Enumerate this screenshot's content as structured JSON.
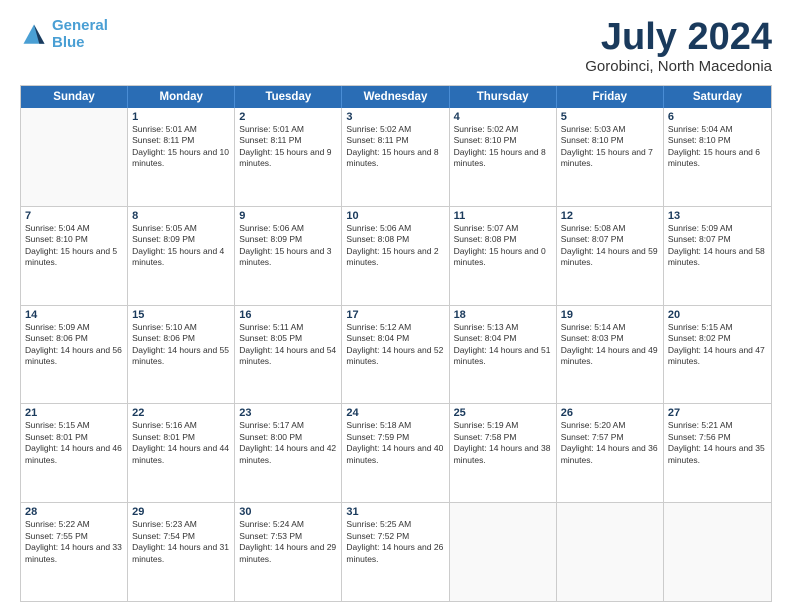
{
  "logo": {
    "line1": "General",
    "line2": "Blue"
  },
  "title": "July 2024",
  "location": "Gorobinci, North Macedonia",
  "header_days": [
    "Sunday",
    "Monday",
    "Tuesday",
    "Wednesday",
    "Thursday",
    "Friday",
    "Saturday"
  ],
  "weeks": [
    [
      {
        "day": "",
        "sunrise": "",
        "sunset": "",
        "daylight": "",
        "empty": true
      },
      {
        "day": "1",
        "sunrise": "Sunrise: 5:01 AM",
        "sunset": "Sunset: 8:11 PM",
        "daylight": "Daylight: 15 hours and 10 minutes."
      },
      {
        "day": "2",
        "sunrise": "Sunrise: 5:01 AM",
        "sunset": "Sunset: 8:11 PM",
        "daylight": "Daylight: 15 hours and 9 minutes."
      },
      {
        "day": "3",
        "sunrise": "Sunrise: 5:02 AM",
        "sunset": "Sunset: 8:11 PM",
        "daylight": "Daylight: 15 hours and 8 minutes."
      },
      {
        "day": "4",
        "sunrise": "Sunrise: 5:02 AM",
        "sunset": "Sunset: 8:10 PM",
        "daylight": "Daylight: 15 hours and 8 minutes."
      },
      {
        "day": "5",
        "sunrise": "Sunrise: 5:03 AM",
        "sunset": "Sunset: 8:10 PM",
        "daylight": "Daylight: 15 hours and 7 minutes."
      },
      {
        "day": "6",
        "sunrise": "Sunrise: 5:04 AM",
        "sunset": "Sunset: 8:10 PM",
        "daylight": "Daylight: 15 hours and 6 minutes."
      }
    ],
    [
      {
        "day": "7",
        "sunrise": "Sunrise: 5:04 AM",
        "sunset": "Sunset: 8:10 PM",
        "daylight": "Daylight: 15 hours and 5 minutes."
      },
      {
        "day": "8",
        "sunrise": "Sunrise: 5:05 AM",
        "sunset": "Sunset: 8:09 PM",
        "daylight": "Daylight: 15 hours and 4 minutes."
      },
      {
        "day": "9",
        "sunrise": "Sunrise: 5:06 AM",
        "sunset": "Sunset: 8:09 PM",
        "daylight": "Daylight: 15 hours and 3 minutes."
      },
      {
        "day": "10",
        "sunrise": "Sunrise: 5:06 AM",
        "sunset": "Sunset: 8:08 PM",
        "daylight": "Daylight: 15 hours and 2 minutes."
      },
      {
        "day": "11",
        "sunrise": "Sunrise: 5:07 AM",
        "sunset": "Sunset: 8:08 PM",
        "daylight": "Daylight: 15 hours and 0 minutes."
      },
      {
        "day": "12",
        "sunrise": "Sunrise: 5:08 AM",
        "sunset": "Sunset: 8:07 PM",
        "daylight": "Daylight: 14 hours and 59 minutes."
      },
      {
        "day": "13",
        "sunrise": "Sunrise: 5:09 AM",
        "sunset": "Sunset: 8:07 PM",
        "daylight": "Daylight: 14 hours and 58 minutes."
      }
    ],
    [
      {
        "day": "14",
        "sunrise": "Sunrise: 5:09 AM",
        "sunset": "Sunset: 8:06 PM",
        "daylight": "Daylight: 14 hours and 56 minutes."
      },
      {
        "day": "15",
        "sunrise": "Sunrise: 5:10 AM",
        "sunset": "Sunset: 8:06 PM",
        "daylight": "Daylight: 14 hours and 55 minutes."
      },
      {
        "day": "16",
        "sunrise": "Sunrise: 5:11 AM",
        "sunset": "Sunset: 8:05 PM",
        "daylight": "Daylight: 14 hours and 54 minutes."
      },
      {
        "day": "17",
        "sunrise": "Sunrise: 5:12 AM",
        "sunset": "Sunset: 8:04 PM",
        "daylight": "Daylight: 14 hours and 52 minutes."
      },
      {
        "day": "18",
        "sunrise": "Sunrise: 5:13 AM",
        "sunset": "Sunset: 8:04 PM",
        "daylight": "Daylight: 14 hours and 51 minutes."
      },
      {
        "day": "19",
        "sunrise": "Sunrise: 5:14 AM",
        "sunset": "Sunset: 8:03 PM",
        "daylight": "Daylight: 14 hours and 49 minutes."
      },
      {
        "day": "20",
        "sunrise": "Sunrise: 5:15 AM",
        "sunset": "Sunset: 8:02 PM",
        "daylight": "Daylight: 14 hours and 47 minutes."
      }
    ],
    [
      {
        "day": "21",
        "sunrise": "Sunrise: 5:15 AM",
        "sunset": "Sunset: 8:01 PM",
        "daylight": "Daylight: 14 hours and 46 minutes."
      },
      {
        "day": "22",
        "sunrise": "Sunrise: 5:16 AM",
        "sunset": "Sunset: 8:01 PM",
        "daylight": "Daylight: 14 hours and 44 minutes."
      },
      {
        "day": "23",
        "sunrise": "Sunrise: 5:17 AM",
        "sunset": "Sunset: 8:00 PM",
        "daylight": "Daylight: 14 hours and 42 minutes."
      },
      {
        "day": "24",
        "sunrise": "Sunrise: 5:18 AM",
        "sunset": "Sunset: 7:59 PM",
        "daylight": "Daylight: 14 hours and 40 minutes."
      },
      {
        "day": "25",
        "sunrise": "Sunrise: 5:19 AM",
        "sunset": "Sunset: 7:58 PM",
        "daylight": "Daylight: 14 hours and 38 minutes."
      },
      {
        "day": "26",
        "sunrise": "Sunrise: 5:20 AM",
        "sunset": "Sunset: 7:57 PM",
        "daylight": "Daylight: 14 hours and 36 minutes."
      },
      {
        "day": "27",
        "sunrise": "Sunrise: 5:21 AM",
        "sunset": "Sunset: 7:56 PM",
        "daylight": "Daylight: 14 hours and 35 minutes."
      }
    ],
    [
      {
        "day": "28",
        "sunrise": "Sunrise: 5:22 AM",
        "sunset": "Sunset: 7:55 PM",
        "daylight": "Daylight: 14 hours and 33 minutes."
      },
      {
        "day": "29",
        "sunrise": "Sunrise: 5:23 AM",
        "sunset": "Sunset: 7:54 PM",
        "daylight": "Daylight: 14 hours and 31 minutes."
      },
      {
        "day": "30",
        "sunrise": "Sunrise: 5:24 AM",
        "sunset": "Sunset: 7:53 PM",
        "daylight": "Daylight: 14 hours and 29 minutes."
      },
      {
        "day": "31",
        "sunrise": "Sunrise: 5:25 AM",
        "sunset": "Sunset: 7:52 PM",
        "daylight": "Daylight: 14 hours and 26 minutes."
      },
      {
        "day": "",
        "sunrise": "",
        "sunset": "",
        "daylight": "",
        "empty": true
      },
      {
        "day": "",
        "sunrise": "",
        "sunset": "",
        "daylight": "",
        "empty": true
      },
      {
        "day": "",
        "sunrise": "",
        "sunset": "",
        "daylight": "",
        "empty": true
      }
    ]
  ]
}
